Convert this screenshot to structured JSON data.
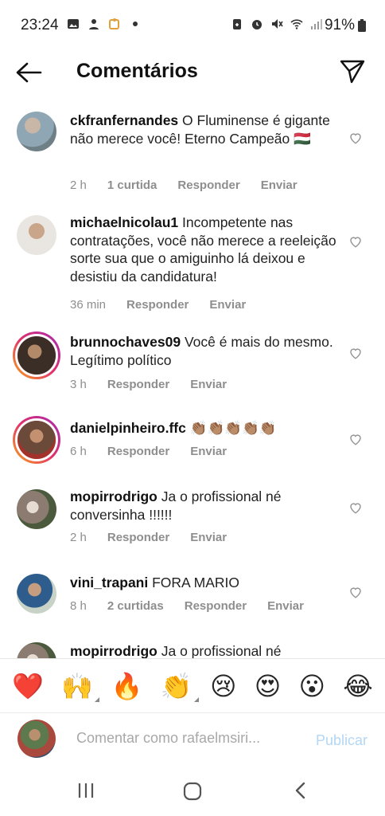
{
  "status_bar": {
    "time": "23:24",
    "battery": "91%",
    "left_icons": [
      "image-icon",
      "person-icon",
      "puzzle-icon",
      "dot-icon"
    ],
    "right_icons": [
      "battery-saver-icon",
      "alarm-icon",
      "mute-icon",
      "wifi-icon",
      "signal-icon"
    ]
  },
  "header": {
    "title": "Comentários"
  },
  "comments": [
    {
      "username": "ckfranfernandes",
      "text": "O Fluminense é gigante não merece você! Eterno Campeão 🇭🇺",
      "time": "2 h",
      "likes": "1 curtida",
      "reply": "Responder",
      "send": "Enviar",
      "avatar_color": "#9aa7b0"
    },
    {
      "username": "michaelnicolau1",
      "text": "Incompetente nas contratações,  você não merece a reeleição sorte sua que o amiguinho lá deixou e desistiu da candidatura!",
      "time": "36 min",
      "likes": "",
      "reply": "Responder",
      "send": "Enviar",
      "avatar_color": "#d9d4cf"
    },
    {
      "username": "brunnochaves09",
      "text": "Você é mais do mesmo. Legítimo político",
      "time": "3 h",
      "likes": "",
      "reply": "Responder",
      "send": "Enviar",
      "avatar_color": "#5a4a3f"
    },
    {
      "username": "danielpinheiro.ffc",
      "text": "👏🏽👏🏽👏🏽👏🏽👏🏽",
      "time": "6 h",
      "likes": "",
      "reply": "Responder",
      "send": "Enviar",
      "avatar_color": "#7b5b4a"
    },
    {
      "username": "mopirrodrigo",
      "text": "Ja o profissional né conversinha !!!!!!",
      "time": "2 h",
      "likes": "",
      "reply": "Responder",
      "send": "Enviar",
      "avatar_color": "#b9a89a"
    },
    {
      "username": "vini_trapani",
      "text": "FORA MARIO",
      "time": "8 h",
      "likes": "2 curtidas",
      "reply": "Responder",
      "send": "Enviar",
      "avatar_color": "#3f6f92"
    },
    {
      "username": "mopirrodrigo",
      "text": "Ja o profissional né",
      "time": "",
      "likes": "",
      "reply": "",
      "send": "",
      "avatar_color": "#b9a89a"
    }
  ],
  "emoji_bar": [
    "❤️",
    "🙌",
    "🔥",
    "👏",
    "😢",
    "😍",
    "😮",
    "😂"
  ],
  "input": {
    "placeholder": "Comentar como rafaelmsiri...",
    "publish_label": "Publicar"
  },
  "colors": {
    "publish_disabled": "#b3d7f5",
    "meta_gray": "#8e8e8e",
    "story_ring": "#e1306c"
  }
}
